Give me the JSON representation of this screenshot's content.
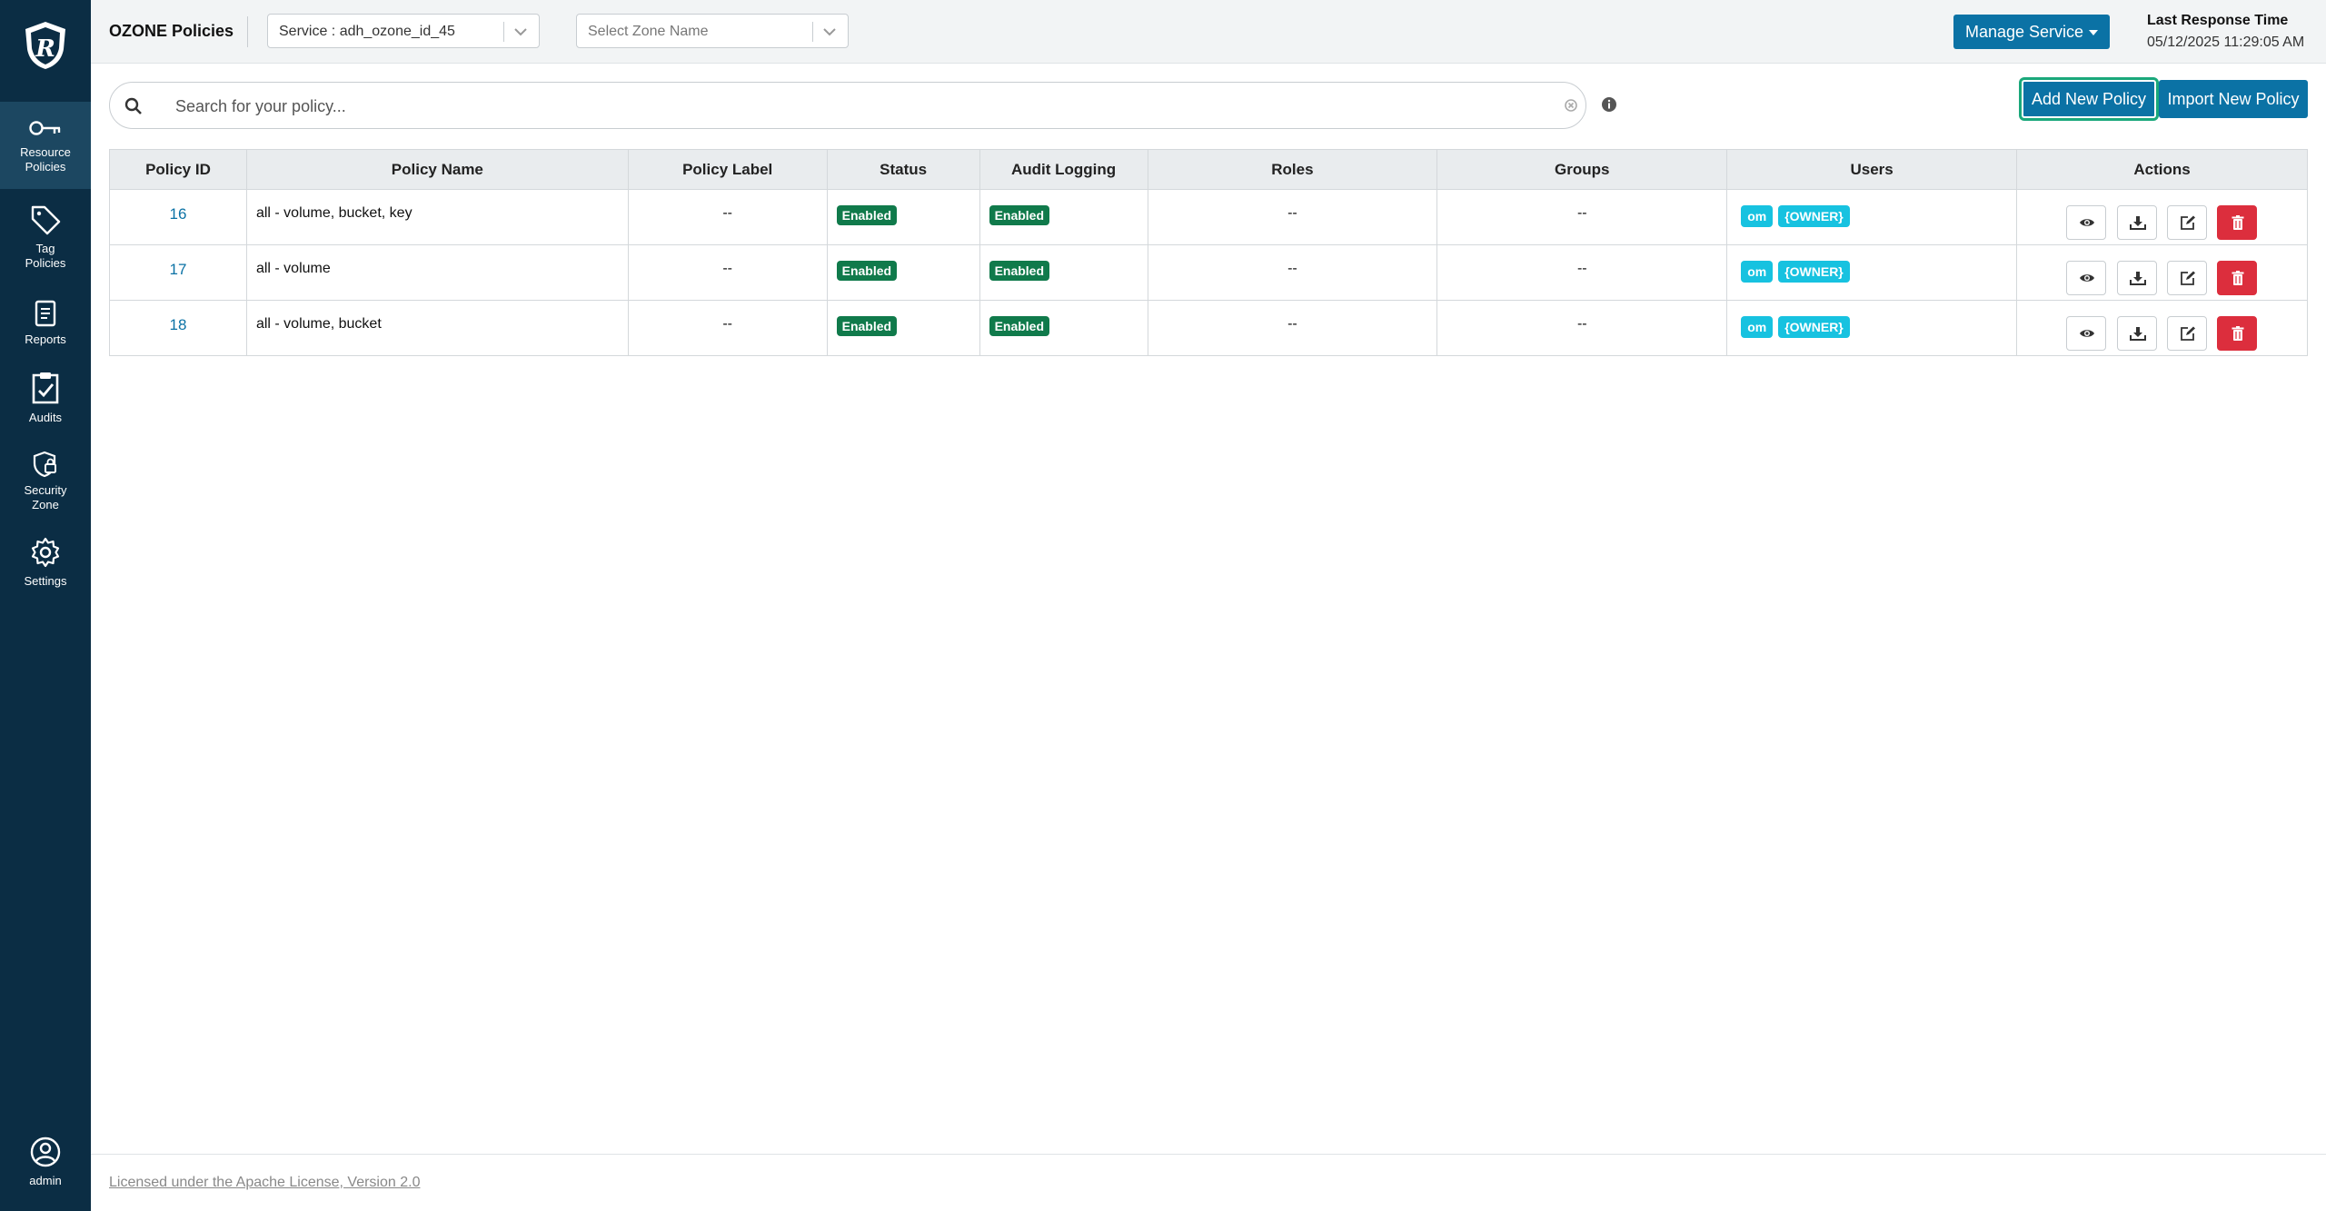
{
  "sidebar": {
    "items": [
      {
        "key": "resource",
        "label": "Resource\nPolicies",
        "icon": "key-icon",
        "active": true
      },
      {
        "key": "tag",
        "label": "Tag\nPolicies",
        "icon": "tag-icon"
      },
      {
        "key": "reports",
        "label": "Reports",
        "icon": "document-icon"
      },
      {
        "key": "audits",
        "label": "Audits",
        "icon": "clipboard-check-icon"
      },
      {
        "key": "security",
        "label": "Security\nZone",
        "icon": "shield-lock-icon"
      },
      {
        "key": "settings",
        "label": "Settings",
        "icon": "gear-icon"
      }
    ],
    "user": {
      "label": "admin",
      "icon": "user-circle-icon"
    }
  },
  "header": {
    "title": "OZONE Policies",
    "service_select": "Service : adh_ozone_id_45",
    "zone_select_placeholder": "Select Zone Name",
    "manage_service_label": "Manage Service",
    "last_response_label": "Last Response Time",
    "last_response_value": "05/12/2025 11:29:05 AM"
  },
  "search": {
    "placeholder": "Search for your policy..."
  },
  "buttons": {
    "add_new_policy": "Add New Policy",
    "import_new_policy": "Import New Policy"
  },
  "table": {
    "columns": [
      "Policy ID",
      "Policy Name",
      "Policy Label",
      "Status",
      "Audit Logging",
      "Roles",
      "Groups",
      "Users",
      "Actions"
    ],
    "rows": [
      {
        "id": "16",
        "name": "all - volume, bucket, key",
        "label": "--",
        "status": "Enabled",
        "audit": "Enabled",
        "roles": "--",
        "groups": "--",
        "users": [
          "om",
          "{OWNER}"
        ]
      },
      {
        "id": "17",
        "name": "all - volume",
        "label": "--",
        "status": "Enabled",
        "audit": "Enabled",
        "roles": "--",
        "groups": "--",
        "users": [
          "om",
          "{OWNER}"
        ]
      },
      {
        "id": "18",
        "name": "all - volume, bucket",
        "label": "--",
        "status": "Enabled",
        "audit": "Enabled",
        "roles": "--",
        "groups": "--",
        "users": [
          "om",
          "{OWNER}"
        ]
      }
    ]
  },
  "footer": {
    "license": "Licensed under the Apache License, Version 2.0"
  },
  "colors": {
    "sidebar_bg": "#0b2d44",
    "primary": "#0b72a5",
    "enabled_green": "#107a4b",
    "user_badge": "#17c2e0",
    "danger": "#dc2e3d"
  }
}
